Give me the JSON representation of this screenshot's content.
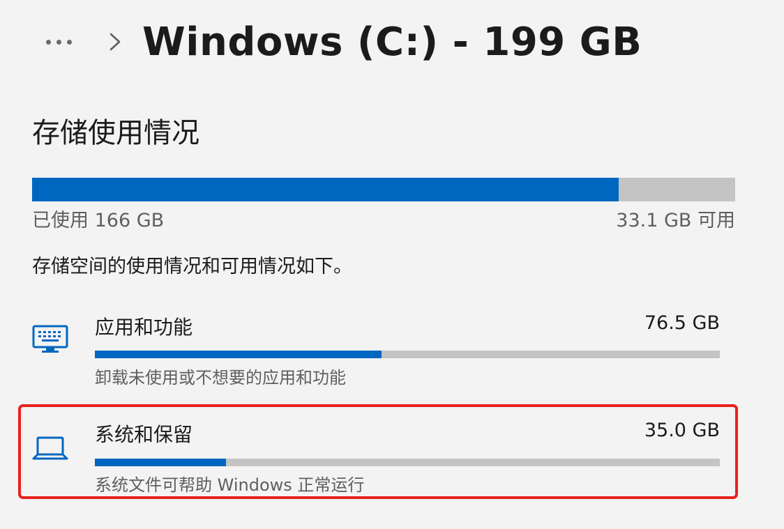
{
  "header": {
    "title": "Windows (C:) - 199 GB",
    "more_icon": "more-ellipsis-icon",
    "separator_icon": "chevron-right-icon"
  },
  "storage": {
    "heading": "存储使用情况",
    "used_label": "已使用 166 GB",
    "free_label": "33.1 GB 可用",
    "used_fraction": 0.834,
    "description": "存储空间的使用情况和可用情况如下。"
  },
  "categories": [
    {
      "name": "应用和功能",
      "size": "76.5 GB",
      "subtitle": "卸载未使用或不想要的应用和功能",
      "fraction": 0.459,
      "icon": "keyboard-icon",
      "highlighted": false
    },
    {
      "name": "系统和保留",
      "size": "35.0 GB",
      "subtitle": "系统文件可帮助 Windows 正常运行",
      "fraction": 0.21,
      "icon": "laptop-icon",
      "highlighted": true
    }
  ],
  "colors": {
    "accent": "#0067c0",
    "track": "#c4c4c4",
    "highlight": "#e8211d",
    "icon_blue": "#0067c0"
  }
}
